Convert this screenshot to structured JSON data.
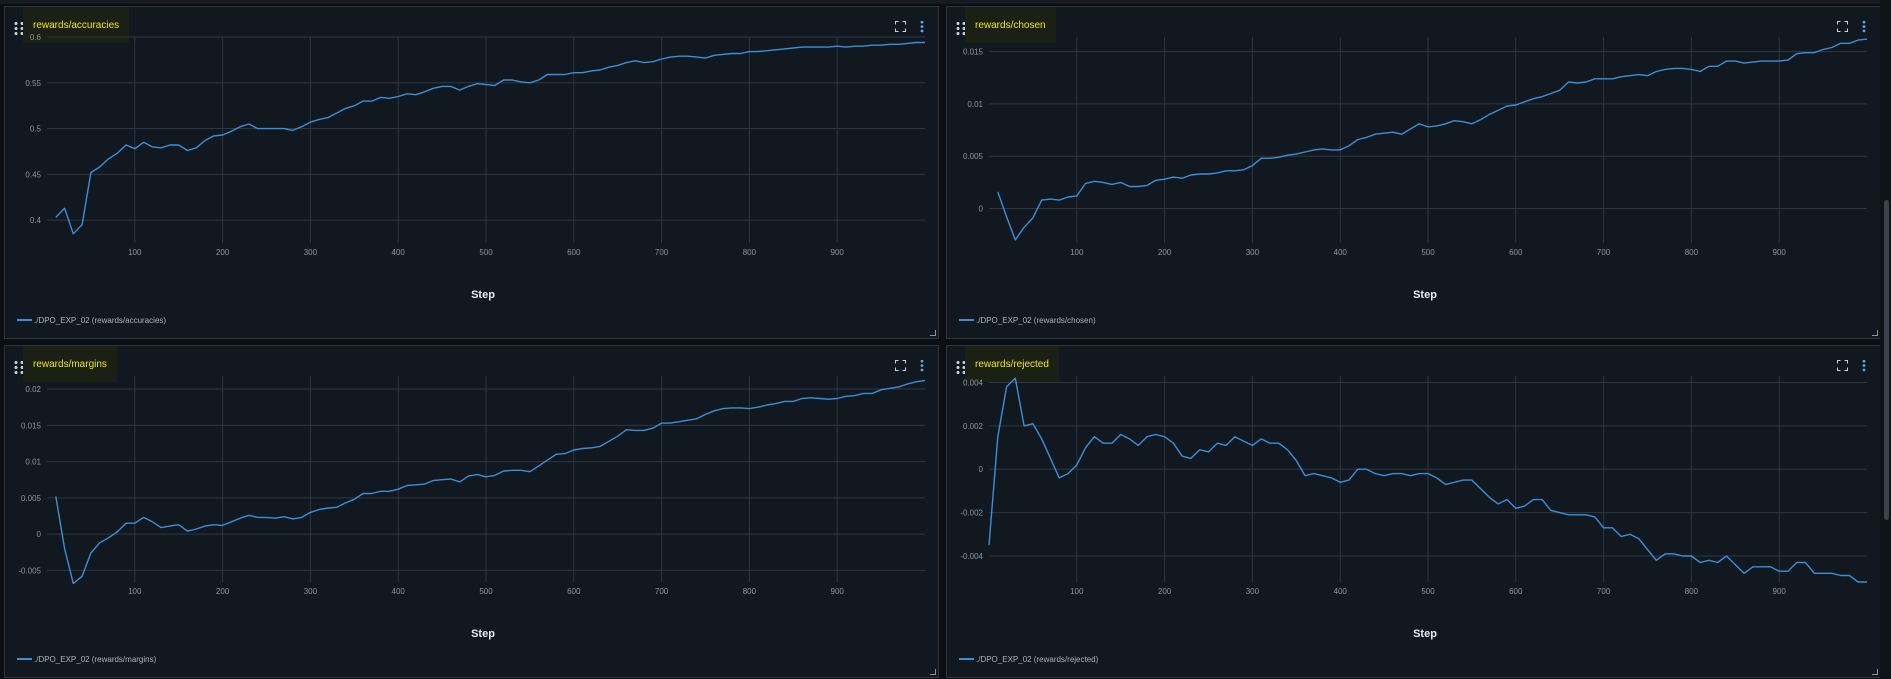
{
  "colors": {
    "line": "#3b8fd9",
    "grid": "#2e3640",
    "title_text": "#f3e600",
    "tick": "#8b96a3",
    "axis_title": "#e6edf3"
  },
  "chart_data": [
    {
      "type": "line",
      "title": "rewards/accuracies",
      "xlabel": "Step",
      "ylabel": "",
      "xlim": [
        0,
        1000
      ],
      "ylim": [
        0.375,
        0.6
      ],
      "xticks": [
        100,
        200,
        300,
        400,
        500,
        600,
        700,
        800,
        900
      ],
      "xtick_labels": [
        "100",
        "200",
        "300",
        "400",
        "500",
        "600",
        "700",
        "800",
        "900"
      ],
      "yticks": [
        0.4,
        0.45,
        0.5,
        0.55,
        0.6
      ],
      "ytick_labels": [
        "0.4",
        "0.45",
        "0.5",
        "0.55",
        "0.6"
      ],
      "grid": true,
      "legend_position": "bottom-left",
      "series": [
        {
          "name": "./DPO_EXP_02 (rewards/accuracies)",
          "x": [
            10,
            20,
            30,
            40,
            50,
            60,
            70,
            80,
            90,
            100,
            110,
            120,
            130,
            140,
            150,
            160,
            170,
            180,
            190,
            200,
            210,
            220,
            230,
            240,
            250,
            260,
            270,
            280,
            290,
            300,
            310,
            320,
            330,
            340,
            350,
            360,
            370,
            380,
            390,
            400,
            410,
            420,
            430,
            440,
            450,
            460,
            470,
            480,
            490,
            500,
            510,
            520,
            530,
            540,
            550,
            560,
            570,
            580,
            590,
            600,
            610,
            620,
            630,
            640,
            650,
            660,
            670,
            680,
            690,
            700,
            710,
            720,
            730,
            740,
            750,
            760,
            770,
            780,
            790,
            800,
            810,
            820,
            830,
            840,
            850,
            860,
            870,
            880,
            890,
            900,
            910,
            920,
            930,
            940,
            950,
            960,
            970,
            980,
            990,
            1000
          ],
          "y": [
            0.403,
            0.413,
            0.385,
            0.395,
            0.452,
            0.458,
            0.467,
            0.473,
            0.482,
            0.478,
            0.485,
            0.48,
            0.479,
            0.482,
            0.482,
            0.476,
            0.479,
            0.487,
            0.492,
            0.493,
            0.497,
            0.502,
            0.505,
            0.5,
            0.5,
            0.5,
            0.5,
            0.498,
            0.502,
            0.507,
            0.51,
            0.512,
            0.517,
            0.522,
            0.525,
            0.53,
            0.53,
            0.534,
            0.533,
            0.535,
            0.538,
            0.537,
            0.54,
            0.544,
            0.546,
            0.546,
            0.542,
            0.546,
            0.549,
            0.548,
            0.547,
            0.553,
            0.553,
            0.551,
            0.55,
            0.553,
            0.559,
            0.559,
            0.559,
            0.561,
            0.561,
            0.563,
            0.564,
            0.567,
            0.569,
            0.572,
            0.574,
            0.572,
            0.573,
            0.576,
            0.578,
            0.579,
            0.579,
            0.578,
            0.577,
            0.58,
            0.581,
            0.582,
            0.582,
            0.584,
            0.584,
            0.585,
            0.586,
            0.587,
            0.588,
            0.589,
            0.589,
            0.589,
            0.589,
            0.59,
            0.589,
            0.59,
            0.59,
            0.591,
            0.591,
            0.592,
            0.592,
            0.593,
            0.594,
            0.594
          ]
        }
      ]
    },
    {
      "type": "line",
      "title": "rewards/chosen",
      "xlabel": "Step",
      "ylabel": "",
      "xlim": [
        0,
        1000
      ],
      "ylim": [
        -0.0033,
        0.0164
      ],
      "xticks": [
        100,
        200,
        300,
        400,
        500,
        600,
        700,
        800,
        900
      ],
      "xtick_labels": [
        "100",
        "200",
        "300",
        "400",
        "500",
        "600",
        "700",
        "800",
        "900"
      ],
      "yticks": [
        0,
        0.005,
        0.01,
        0.015
      ],
      "ytick_labels": [
        "0",
        "0.005",
        "0.01",
        "0.015"
      ],
      "grid": true,
      "legend_position": "bottom-left",
      "series": [
        {
          "name": "./DPO_EXP_02 (rewards/chosen)",
          "x": [
            10,
            20,
            30,
            40,
            50,
            60,
            70,
            80,
            90,
            100,
            110,
            120,
            130,
            140,
            150,
            160,
            170,
            180,
            190,
            200,
            210,
            220,
            230,
            240,
            250,
            260,
            270,
            280,
            290,
            300,
            310,
            320,
            330,
            340,
            350,
            360,
            370,
            380,
            390,
            400,
            410,
            420,
            430,
            440,
            450,
            460,
            470,
            480,
            490,
            500,
            510,
            520,
            530,
            540,
            550,
            560,
            570,
            580,
            590,
            600,
            610,
            620,
            630,
            640,
            650,
            660,
            670,
            680,
            690,
            700,
            710,
            720,
            730,
            740,
            750,
            760,
            770,
            780,
            790,
            800,
            810,
            820,
            830,
            840,
            850,
            860,
            870,
            880,
            890,
            900,
            910,
            920,
            930,
            940,
            950,
            960,
            970,
            980,
            990,
            1000
          ],
          "y": [
            0.0016,
            -0.0008,
            -0.003,
            -0.0018,
            -0.0009,
            0.0008,
            0.0009,
            0.0008,
            0.0011,
            0.0012,
            0.0024,
            0.0026,
            0.0025,
            0.0023,
            0.0025,
            0.0021,
            0.0021,
            0.0022,
            0.0027,
            0.0028,
            0.003,
            0.0029,
            0.0032,
            0.0033,
            0.0033,
            0.0034,
            0.0036,
            0.0036,
            0.0037,
            0.0041,
            0.0048,
            0.0048,
            0.0049,
            0.0051,
            0.0052,
            0.0054,
            0.0056,
            0.0057,
            0.0056,
            0.0056,
            0.006,
            0.0066,
            0.0068,
            0.0071,
            0.0072,
            0.0073,
            0.0071,
            0.0076,
            0.0081,
            0.0078,
            0.0079,
            0.0081,
            0.0084,
            0.0083,
            0.0081,
            0.0085,
            0.009,
            0.0094,
            0.0098,
            0.0099,
            0.0102,
            0.0105,
            0.0107,
            0.011,
            0.0113,
            0.0121,
            0.012,
            0.0121,
            0.0124,
            0.0124,
            0.0124,
            0.0126,
            0.0127,
            0.0128,
            0.0127,
            0.0131,
            0.0133,
            0.0134,
            0.0134,
            0.0133,
            0.0131,
            0.0136,
            0.0136,
            0.0141,
            0.0141,
            0.0139,
            0.014,
            0.0141,
            0.0141,
            0.0141,
            0.0142,
            0.0148,
            0.0149,
            0.0149,
            0.0152,
            0.0154,
            0.0158,
            0.0158,
            0.0161,
            0.0162
          ]
        }
      ]
    },
    {
      "type": "line",
      "title": "rewards/margins",
      "xlabel": "Step",
      "ylabel": "",
      "xlim": [
        0,
        1000
      ],
      "ylim": [
        -0.0066,
        0.0218
      ],
      "xticks": [
        100,
        200,
        300,
        400,
        500,
        600,
        700,
        800,
        900
      ],
      "xtick_labels": [
        "100",
        "200",
        "300",
        "400",
        "500",
        "600",
        "700",
        "800",
        "900"
      ],
      "yticks": [
        -0.005,
        0,
        0.005,
        0.01,
        0.015,
        0.02
      ],
      "ytick_labels": [
        "-0.005",
        "0",
        "0.005",
        "0.01",
        "0.015",
        "0.02"
      ],
      "grid": true,
      "legend_position": "bottom-left",
      "series": [
        {
          "name": "./DPO_EXP_02 (rewards/margins)",
          "x": [
            10,
            20,
            30,
            40,
            50,
            60,
            70,
            80,
            90,
            100,
            110,
            120,
            130,
            140,
            150,
            160,
            170,
            180,
            190,
            200,
            210,
            220,
            230,
            240,
            250,
            260,
            270,
            280,
            290,
            300,
            310,
            320,
            330,
            340,
            350,
            360,
            370,
            380,
            390,
            400,
            410,
            420,
            430,
            440,
            450,
            460,
            470,
            480,
            490,
            500,
            510,
            520,
            530,
            540,
            550,
            560,
            570,
            580,
            590,
            600,
            610,
            620,
            630,
            640,
            650,
            660,
            670,
            680,
            690,
            700,
            710,
            720,
            730,
            740,
            750,
            760,
            770,
            780,
            790,
            800,
            810,
            820,
            830,
            840,
            850,
            860,
            870,
            880,
            890,
            900,
            910,
            920,
            930,
            940,
            950,
            960,
            970,
            980,
            990,
            1000
          ],
          "y": [
            0.0052,
            -0.002,
            -0.0068,
            -0.0058,
            -0.0026,
            -0.0012,
            -0.0005,
            0.0003,
            0.0015,
            0.0015,
            0.0023,
            0.0017,
            0.0009,
            0.0011,
            0.0013,
            0.0004,
            0.0007,
            0.0011,
            0.0013,
            0.0012,
            0.0017,
            0.0022,
            0.0026,
            0.0023,
            0.0023,
            0.0022,
            0.0024,
            0.0021,
            0.0023,
            0.003,
            0.0034,
            0.0036,
            0.0037,
            0.0043,
            0.0048,
            0.0056,
            0.0056,
            0.0059,
            0.0059,
            0.0062,
            0.0067,
            0.0068,
            0.0069,
            0.0074,
            0.0075,
            0.0076,
            0.0072,
            0.008,
            0.0082,
            0.0079,
            0.0081,
            0.0087,
            0.0088,
            0.0088,
            0.0086,
            0.0094,
            0.0102,
            0.011,
            0.0111,
            0.0116,
            0.0118,
            0.0119,
            0.0121,
            0.0128,
            0.0135,
            0.0144,
            0.0143,
            0.0143,
            0.0146,
            0.0153,
            0.0153,
            0.0155,
            0.0157,
            0.0159,
            0.0165,
            0.017,
            0.0173,
            0.0174,
            0.0174,
            0.0173,
            0.0175,
            0.0178,
            0.018,
            0.0183,
            0.0183,
            0.0187,
            0.0188,
            0.0187,
            0.0186,
            0.0187,
            0.019,
            0.0191,
            0.0194,
            0.0194,
            0.0199,
            0.0201,
            0.0203,
            0.0207,
            0.021,
            0.0212
          ]
        }
      ]
    },
    {
      "type": "line",
      "title": "rewards/rejected",
      "xlabel": "Step",
      "ylabel": "",
      "xlim": [
        0,
        1000
      ],
      "ylim": [
        -0.0052,
        0.0043
      ],
      "xticks": [
        100,
        200,
        300,
        400,
        500,
        600,
        700,
        800,
        900
      ],
      "xtick_labels": [
        "100",
        "200",
        "300",
        "400",
        "500",
        "600",
        "700",
        "800",
        "900"
      ],
      "yticks": [
        -0.004,
        -0.002,
        0,
        0.002,
        0.004
      ],
      "ytick_labels": [
        "-0.004",
        "-0.002",
        "0",
        "0.002",
        "0.004"
      ],
      "grid": true,
      "legend_position": "bottom-left",
      "series": [
        {
          "name": "./DPO_EXP_02 (rewards/rejected)",
          "x": [
            0,
            10,
            20,
            30,
            40,
            50,
            60,
            70,
            80,
            90,
            100,
            110,
            120,
            130,
            140,
            150,
            160,
            170,
            180,
            190,
            200,
            210,
            220,
            230,
            240,
            250,
            260,
            270,
            280,
            290,
            300,
            310,
            320,
            330,
            340,
            350,
            360,
            370,
            380,
            390,
            400,
            410,
            420,
            430,
            440,
            450,
            460,
            470,
            480,
            490,
            500,
            510,
            520,
            530,
            540,
            550,
            560,
            570,
            580,
            590,
            600,
            610,
            620,
            630,
            640,
            650,
            660,
            670,
            680,
            690,
            700,
            710,
            720,
            730,
            740,
            750,
            760,
            770,
            780,
            790,
            800,
            810,
            820,
            830,
            840,
            850,
            860,
            870,
            880,
            890,
            900,
            910,
            920,
            930,
            940,
            950,
            960,
            970,
            980,
            990,
            1000
          ],
          "y": [
            -0.0035,
            0.0015,
            0.0038,
            0.0042,
            0.002,
            0.0021,
            0.0014,
            0.0005,
            -0.0004,
            -0.0002,
            0.0002,
            0.001,
            0.0015,
            0.0012,
            0.0012,
            0.0016,
            0.0014,
            0.0011,
            0.0015,
            0.0016,
            0.0015,
            0.0012,
            0.0006,
            0.0005,
            0.0009,
            0.0008,
            0.0012,
            0.0011,
            0.0015,
            0.0013,
            0.0011,
            0.0014,
            0.0012,
            0.0012,
            0.0009,
            0.0004,
            -0.0003,
            -0.0002,
            -0.0003,
            -0.0004,
            -0.0006,
            -0.0005,
            0.0,
            0.0,
            -0.0002,
            -0.0003,
            -0.0002,
            -0.0002,
            -0.0003,
            -0.0002,
            -0.0002,
            -0.0004,
            -0.0007,
            -0.0006,
            -0.0005,
            -0.0005,
            -0.0009,
            -0.0013,
            -0.0016,
            -0.0014,
            -0.0018,
            -0.0017,
            -0.0014,
            -0.0014,
            -0.0019,
            -0.002,
            -0.0021,
            -0.0021,
            -0.0021,
            -0.0022,
            -0.0027,
            -0.0027,
            -0.0031,
            -0.003,
            -0.0032,
            -0.0037,
            -0.0042,
            -0.0039,
            -0.0039,
            -0.004,
            -0.004,
            -0.0043,
            -0.0042,
            -0.0043,
            -0.004,
            -0.0044,
            -0.0048,
            -0.0045,
            -0.0045,
            -0.0045,
            -0.0047,
            -0.0047,
            -0.0043,
            -0.0043,
            -0.0048,
            -0.0048,
            -0.0048,
            -0.0049,
            -0.0049,
            -0.0052,
            -0.0052
          ]
        }
      ]
    }
  ]
}
